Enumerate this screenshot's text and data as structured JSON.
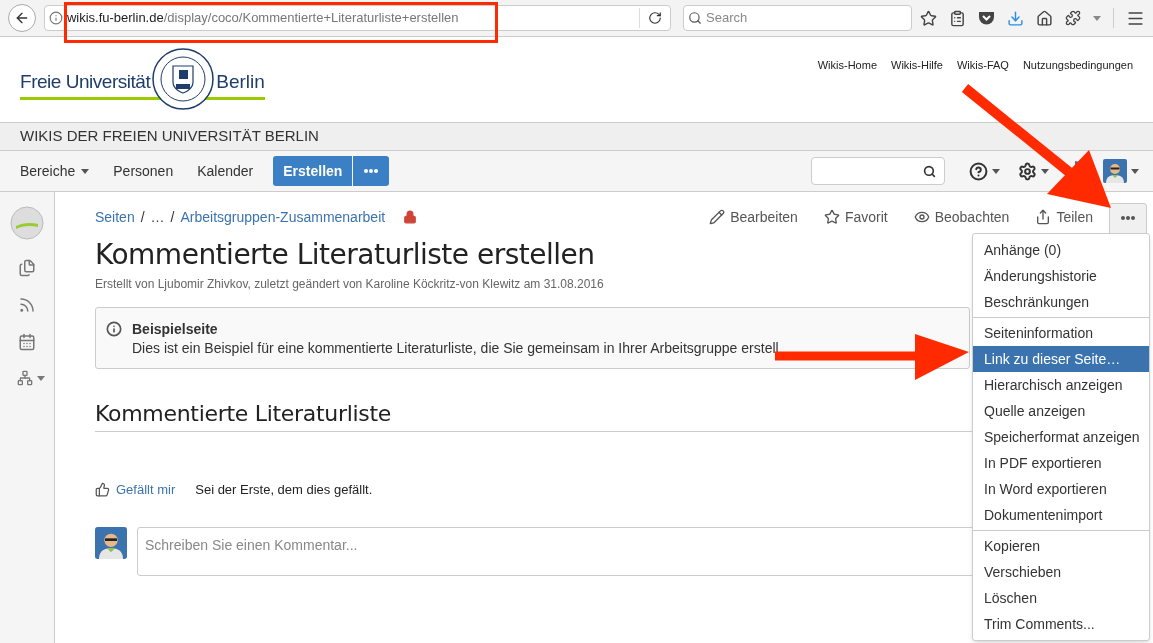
{
  "browser": {
    "url": {
      "domain": "wikis.fu-berlin.de",
      "path": "/display/coco/Kommentierte+Literaturliste+erstellen"
    },
    "search_placeholder": "Search"
  },
  "header": {
    "logo": {
      "left": "Freie Universität",
      "right": "Berlin"
    },
    "links": [
      "Wikis-Home",
      "Wikis-Hilfe",
      "Wikis-FAQ",
      "Nutzungsbedingungen"
    ]
  },
  "site_title": "WIKIS DER FREIEN UNIVERSITÄT BERLIN",
  "nav": {
    "items": [
      {
        "label": "Bereiche",
        "dropdown": true
      },
      {
        "label": "Personen",
        "dropdown": false
      },
      {
        "label": "Kalender",
        "dropdown": false
      }
    ],
    "create_button": "Erstellen"
  },
  "breadcrumb": [
    {
      "label": "Seiten",
      "kind": "link"
    },
    {
      "label": "/",
      "kind": "separator"
    },
    {
      "label": "…",
      "kind": "text"
    },
    {
      "label": "/",
      "kind": "separator"
    },
    {
      "label": "Arbeitsgruppen-Zusammenarbeit",
      "kind": "link"
    }
  ],
  "restricted": true,
  "page_actions": [
    {
      "label": "Bearbeiten",
      "kind": "edit"
    },
    {
      "label": "Favorit",
      "kind": "favorite"
    },
    {
      "label": "Beobachten",
      "kind": "watch"
    },
    {
      "label": "Teilen",
      "kind": "share"
    }
  ],
  "page": {
    "title": "Kommentierte Literaturliste erstellen",
    "byline": "Erstellt von Ljubomir Zhivkov, zuletzt geändert von Karoline Köckritz-von Klewitz am 31.08.2016",
    "info_panel": {
      "title": "Beispielseite",
      "text": "Dies ist ein Beispiel für eine kommentierte Literaturliste, die Sie gemeinsam in Ihrer Arbeitsgruppe erstell"
    },
    "heading": "Kommentierte Literaturliste",
    "like": {
      "label": "Gefällt mir",
      "text": "Sei der Erste, dem dies gefällt."
    },
    "comment_placeholder": "Schreiben Sie einen Kommentar..."
  },
  "menu": {
    "groups": [
      [
        {
          "label": "Anhänge (0)",
          "selected": false
        },
        {
          "label": "Änderungshistorie",
          "selected": false
        },
        {
          "label": "Beschränkungen",
          "selected": false
        }
      ],
      [
        {
          "label": "Seiteninformation",
          "selected": false
        },
        {
          "label": "Link zu dieser Seite…",
          "selected": true
        },
        {
          "label": "Hierarchisch anzeigen",
          "selected": false
        },
        {
          "label": "Quelle anzeigen",
          "selected": false
        },
        {
          "label": "Speicherformat anzeigen",
          "selected": false
        },
        {
          "label": "In PDF exportieren",
          "selected": false
        },
        {
          "label": "In Word exportieren",
          "selected": false
        },
        {
          "label": "Dokumentenimport",
          "selected": false
        }
      ],
      [
        {
          "label": "Kopieren",
          "selected": false
        },
        {
          "label": "Verschieben",
          "selected": false
        },
        {
          "label": "Löschen",
          "selected": false
        },
        {
          "label": "Trim Comments...",
          "selected": false
        }
      ]
    ]
  }
}
